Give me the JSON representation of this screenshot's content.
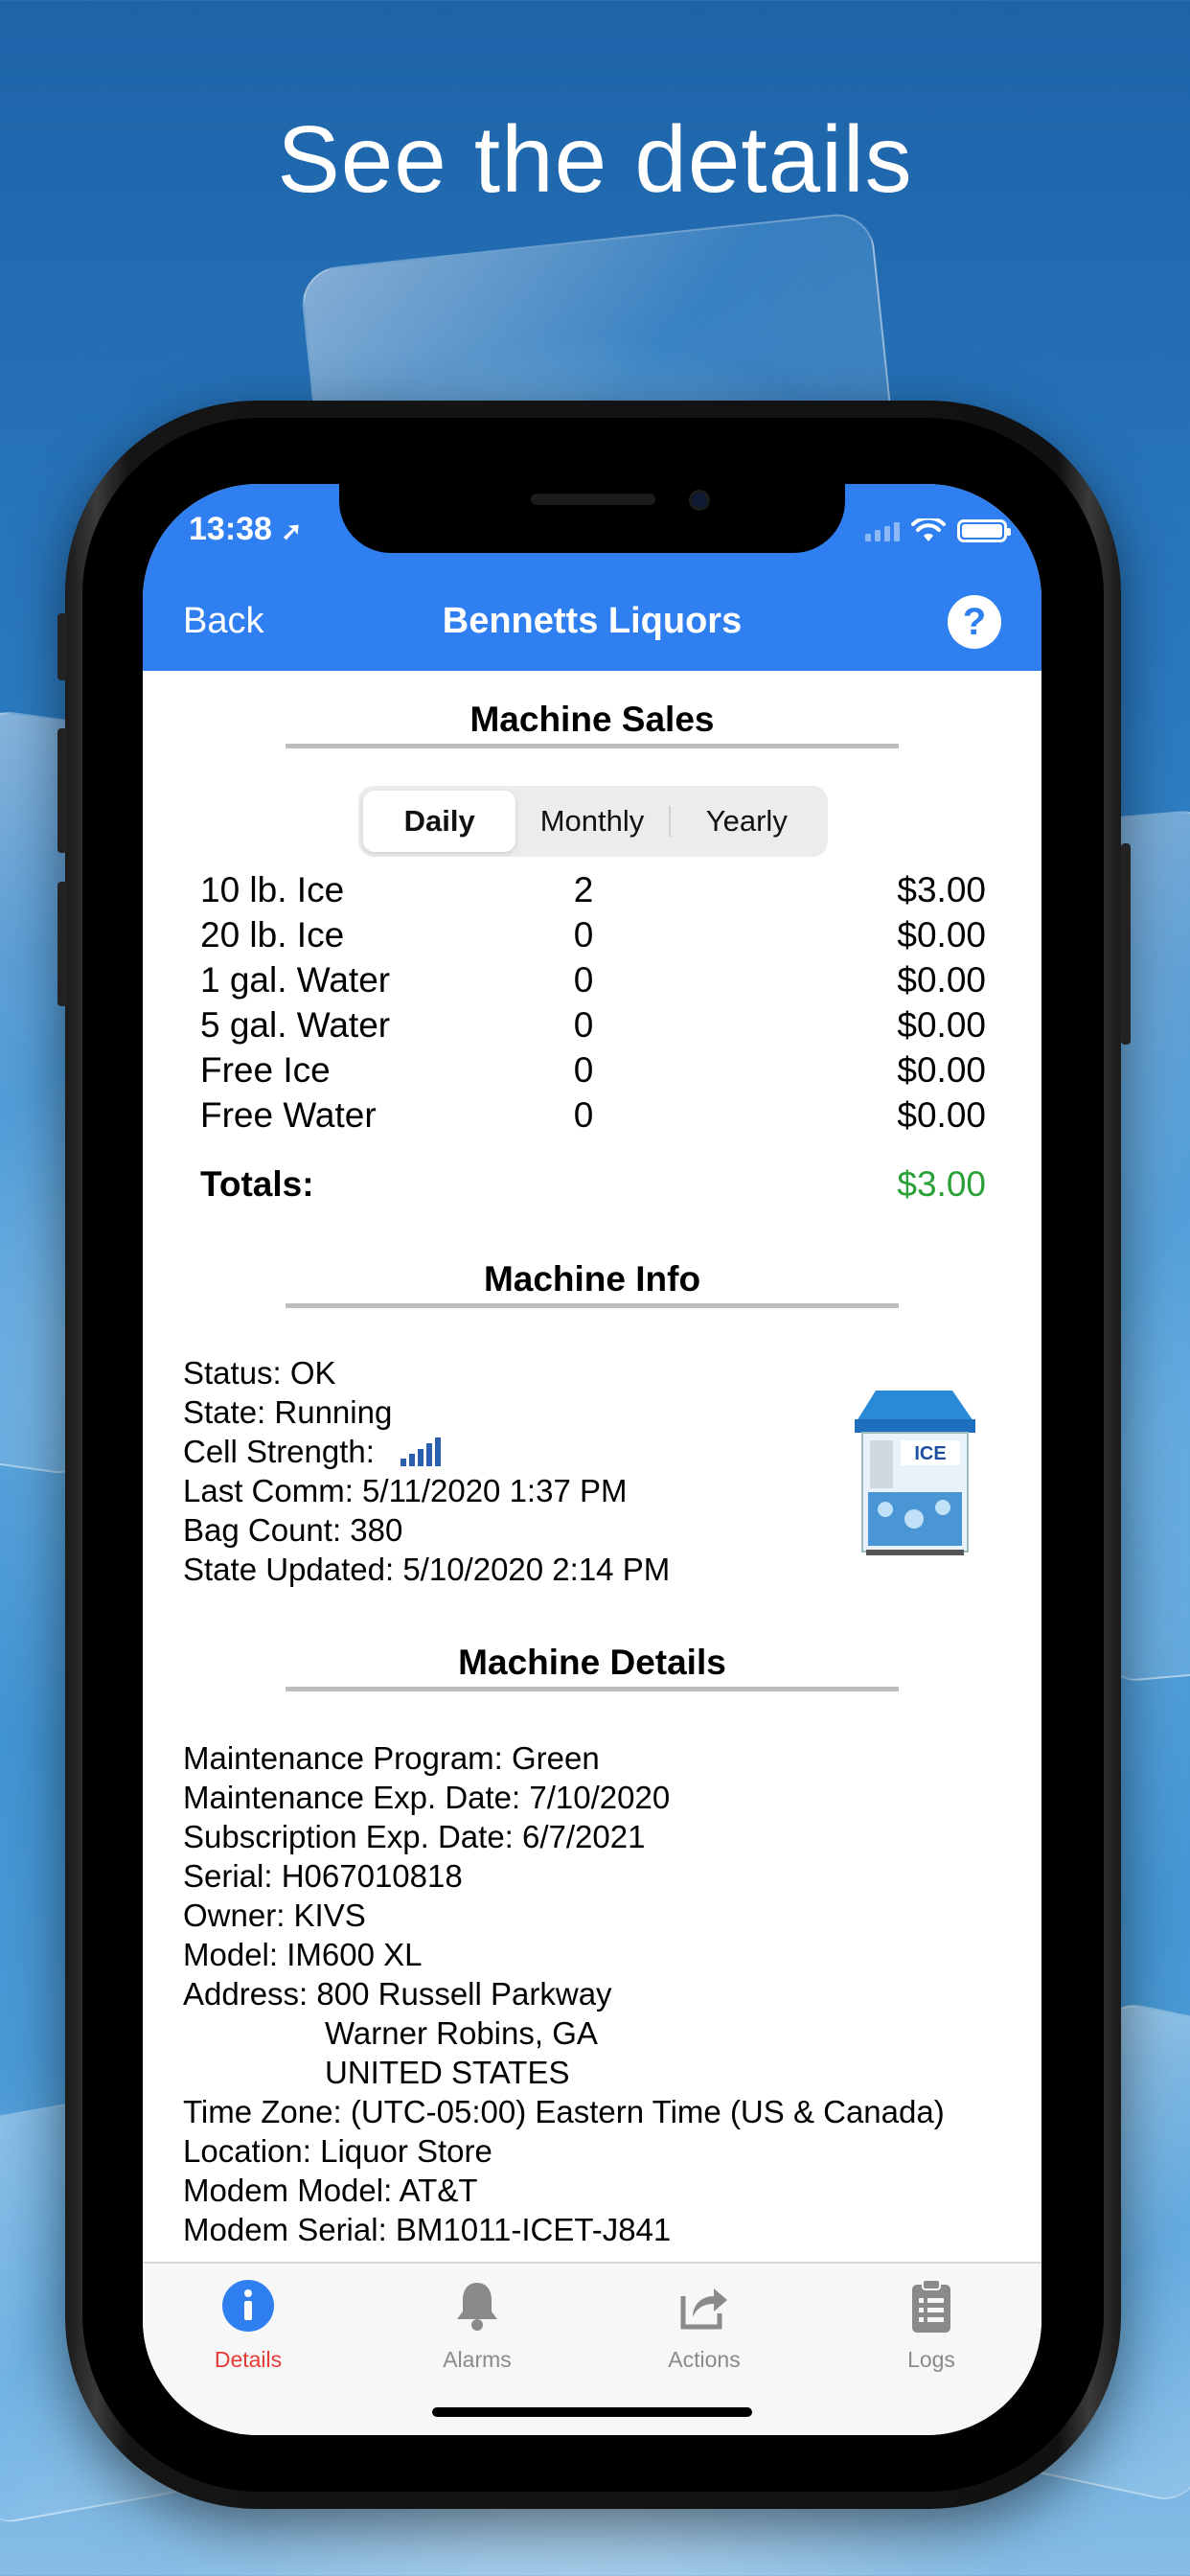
{
  "headline": "See the details",
  "status_bar": {
    "time": "13:38"
  },
  "nav": {
    "back_label": "Back",
    "title": "Bennetts Liquors",
    "help_icon": "?"
  },
  "sales": {
    "title": "Machine Sales",
    "segments": [
      "Daily",
      "Monthly",
      "Yearly"
    ],
    "selected_segment": "Daily",
    "rows": [
      {
        "name": "10 lb. Ice",
        "qty": "2",
        "amount": "$3.00"
      },
      {
        "name": "20 lb. Ice",
        "qty": "0",
        "amount": "$0.00"
      },
      {
        "name": "1 gal. Water",
        "qty": "0",
        "amount": "$0.00"
      },
      {
        "name": "5 gal. Water",
        "qty": "0",
        "amount": "$0.00"
      },
      {
        "name": "Free Ice",
        "qty": "0",
        "amount": "$0.00"
      },
      {
        "name": "Free Water",
        "qty": "0",
        "amount": "$0.00"
      }
    ],
    "totals_label": "Totals:",
    "totals_amount": "$3.00",
    "totals_color": "#2aa136"
  },
  "info": {
    "title": "Machine Info",
    "status": "Status: OK",
    "state": "State: Running",
    "cell_strength_label": "Cell Strength:",
    "cell_strength_bars": 5,
    "last_comm": "Last Comm: 5/11/2020 1:37 PM",
    "bag_count": "Bag Count: 380",
    "state_updated": "State Updated: 5/10/2020 2:14 PM"
  },
  "details": {
    "title": "Machine Details",
    "maintenance_program": "Maintenance Program: Green",
    "maintenance_exp": "Maintenance Exp. Date: 7/10/2020",
    "subscription_exp": "Subscription Exp. Date: 6/7/2021",
    "serial": "Serial: H067010818",
    "owner": "Owner: KIVS",
    "model": "Model: IM600 XL",
    "address_label": "Address:",
    "address_line1": "800 Russell Parkway",
    "address_line2": "Warner Robins, GA",
    "address_line3": "UNITED STATES",
    "time_zone": "Time Zone: (UTC-05:00) Eastern Time (US & Canada)",
    "location": "Location: Liquor Store",
    "modem_model": "Modem Model: AT&T",
    "modem_serial": "Modem Serial: BM1011-ICET-J841"
  },
  "tabbar": {
    "items": [
      {
        "label": "Details",
        "icon": "info-icon",
        "active": true
      },
      {
        "label": "Alarms",
        "icon": "bell-icon",
        "active": false
      },
      {
        "label": "Actions",
        "icon": "share-icon",
        "active": false
      },
      {
        "label": "Logs",
        "icon": "clipboard-icon",
        "active": false
      }
    ]
  },
  "colors": {
    "accent": "#2f7ff0",
    "active_tab": "#e53935",
    "inactive_tab": "#8a8a8a"
  }
}
